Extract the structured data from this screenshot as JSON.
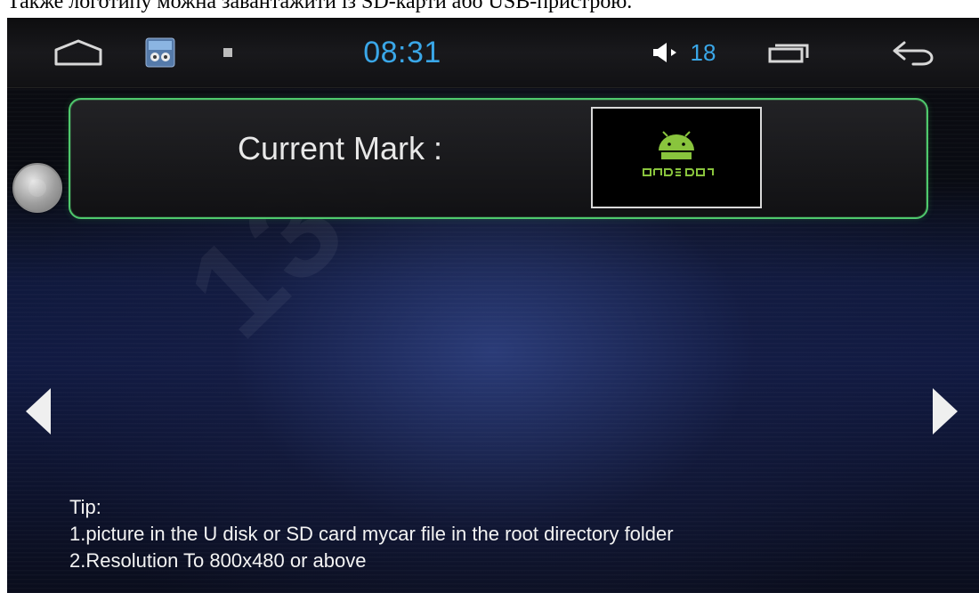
{
  "caption": "Также логотипу можна завантажити із SD-карти або USB-пристрою.",
  "status_bar": {
    "time": "08:31",
    "volume_level": "18",
    "icons": {
      "home": "home-icon",
      "app": "app-thumbnail-icon",
      "square": "stop-square-icon",
      "volume": "volume-icon",
      "recent": "recent-apps-icon",
      "back": "back-icon"
    }
  },
  "mark_panel": {
    "label": "Current Mark :",
    "preview_logo": "android-logo"
  },
  "navigation": {
    "prev": "left-arrow-icon",
    "next": "right-arrow-icon",
    "side_handle": "side-handle-icon"
  },
  "tips": {
    "title": "Tip:",
    "line_1": "1.picture in the U disk or SD card mycar file in the root directory folder",
    "line_2": "2.Resolution To 800x480 or above"
  },
  "colors": {
    "accent": "#3aa7e8",
    "panel_border": "#4fc96d"
  }
}
